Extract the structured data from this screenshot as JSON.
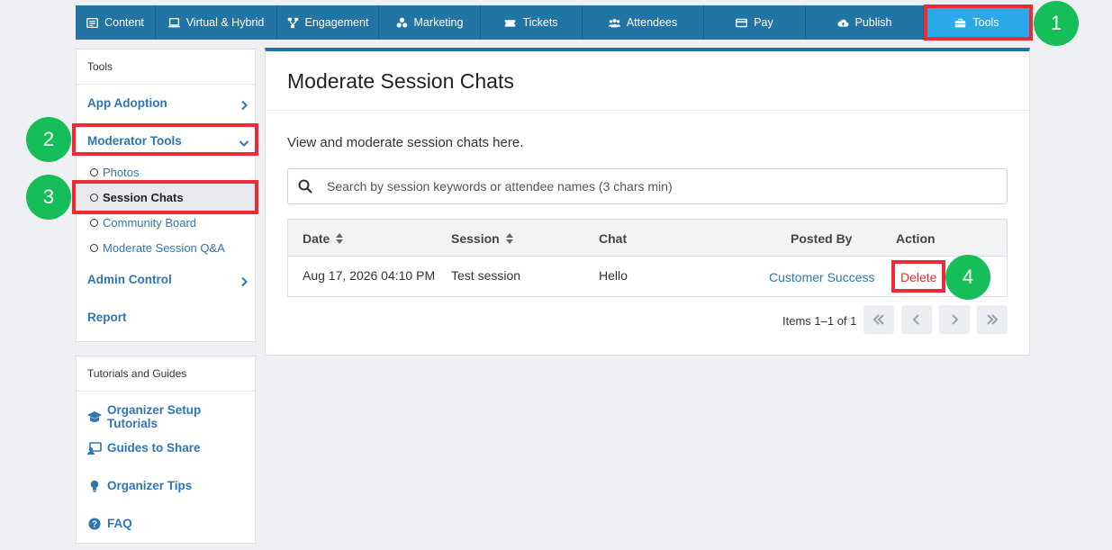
{
  "nav": [
    {
      "label": "Content",
      "icon": "content-icon"
    },
    {
      "label": "Virtual & Hybrid",
      "icon": "monitor-icon"
    },
    {
      "label": "Engagement",
      "icon": "engagement-icon"
    },
    {
      "label": "Marketing",
      "icon": "marketing-icon"
    },
    {
      "label": "Tickets",
      "icon": "ticket-icon"
    },
    {
      "label": "Attendees",
      "icon": "attendees-icon"
    },
    {
      "label": "Pay",
      "icon": "card-icon"
    },
    {
      "label": "Publish",
      "icon": "cloud-upload-icon"
    },
    {
      "label": "Tools",
      "icon": "toolbox-icon",
      "active": true
    }
  ],
  "sidebar": {
    "title": "Tools",
    "app_adoption": "App Adoption",
    "moderator_tools": "Moderator Tools",
    "sub_items": [
      "Photos",
      "Session Chats",
      "Community Board",
      "Moderate Session Q&A"
    ],
    "admin_control": "Admin Control",
    "report": "Report"
  },
  "tutorials": {
    "title": "Tutorials and Guides",
    "items": [
      "Organizer Setup Tutorials",
      "Guides to Share",
      "Organizer Tips",
      "FAQ"
    ]
  },
  "main": {
    "title": "Moderate Session Chats",
    "description": "View and moderate session chats here.",
    "search_placeholder": "Search by session keywords or attendee names (3 chars min)",
    "columns": [
      "Date",
      "Session",
      "Chat",
      "Posted By",
      "Action"
    ],
    "rows": [
      {
        "date": "Aug 17, 2026 04:10 PM",
        "session": "Test session",
        "chat": "Hello",
        "posted_by": "Customer Success",
        "action": "Delete"
      }
    ],
    "pager": "Items 1–1 of 1"
  },
  "badges": [
    "1",
    "2",
    "3",
    "4"
  ],
  "colors": {
    "nav": "#2274a5",
    "nav_active": "#2aa9e8",
    "link": "#2e76b3",
    "highlight": "#ee2a35",
    "badge": "#16be5a",
    "delete": "#d9302c"
  }
}
